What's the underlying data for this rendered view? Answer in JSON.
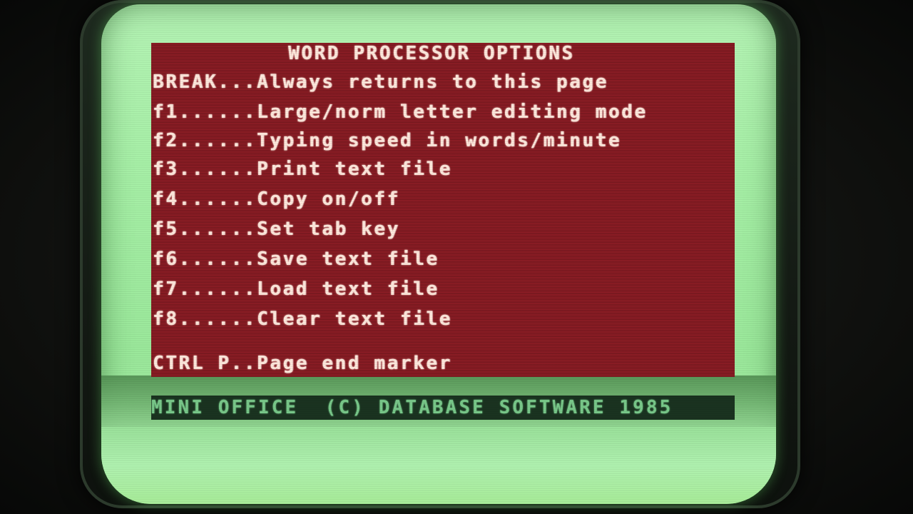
{
  "screen": {
    "title": "WORD PROCESSOR OPTIONS",
    "menu": [
      {
        "key": "BREAK...",
        "action": "Always returns to this page"
      },
      {
        "key": "f1......",
        "action": "Large/norm letter editing mode"
      },
      {
        "key": "f2......",
        "action": "Typing speed in words/minute"
      },
      {
        "key": "f3......",
        "action": "Print text file"
      },
      {
        "key": "f4......",
        "action": "Copy on/off"
      },
      {
        "key": "f5......",
        "action": "Set tab key"
      },
      {
        "key": "f6......",
        "action": "Save text file"
      },
      {
        "key": "f7......",
        "action": "Load text file"
      },
      {
        "key": "f8......",
        "action": "Clear text file"
      },
      {
        "key": "CTRL P..",
        "action": "Page end marker"
      }
    ],
    "status_line": "MINI OFFICE  (C) DATABASE SOFTWARE 1985"
  },
  "colors": {
    "background_window": "#8a1c24",
    "screen_glow": "#a7f1a7",
    "menu_text": "#ffe9dd",
    "status_text": "#79c98a"
  }
}
